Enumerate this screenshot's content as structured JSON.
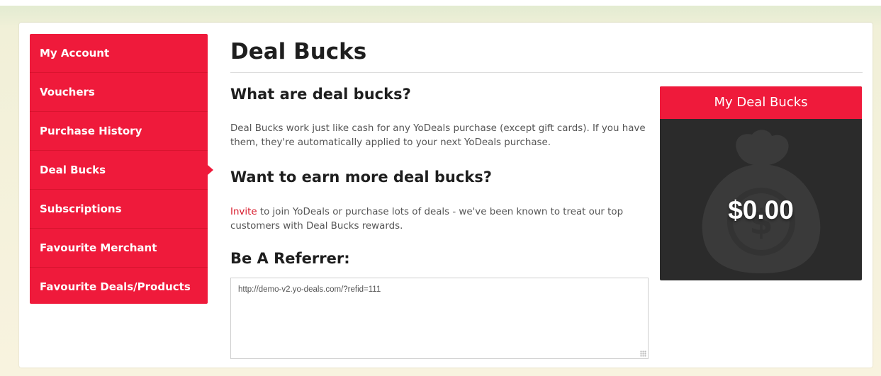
{
  "sidebar": {
    "items": [
      {
        "label": "My Account"
      },
      {
        "label": "Vouchers"
      },
      {
        "label": "Purchase History"
      },
      {
        "label": "Deal Bucks"
      },
      {
        "label": "Subscriptions"
      },
      {
        "label": "Favourite Merchant"
      },
      {
        "label": "Favourite Deals/Products"
      }
    ],
    "active_item": "Deal Bucks"
  },
  "main": {
    "title": "Deal Bucks",
    "section_what": {
      "heading": "What are deal bucks?",
      "text": "Deal Bucks work just like cash for any YoDeals purchase (except gift cards). If you have them, they're automatically applied to your next YoDeals purchase."
    },
    "section_earn": {
      "heading": "Want to earn more deal bucks?",
      "link_text": "Invite",
      "text": " to join YoDeals or purchase lots of deals - we've been known to treat our top customers with Deal Bucks rewards."
    },
    "section_referrer": {
      "heading": "Be A Referrer:",
      "referral_url": "http://demo-v2.yo-deals.com/?refid=111"
    }
  },
  "deal_bucks_card": {
    "header": "My Deal Bucks",
    "amount": "$0.00",
    "icon": "money-bag-icon"
  },
  "colors": {
    "accent": "#ef1a3b",
    "card_background": "#2b2b2b",
    "link": "#d81a2b"
  }
}
